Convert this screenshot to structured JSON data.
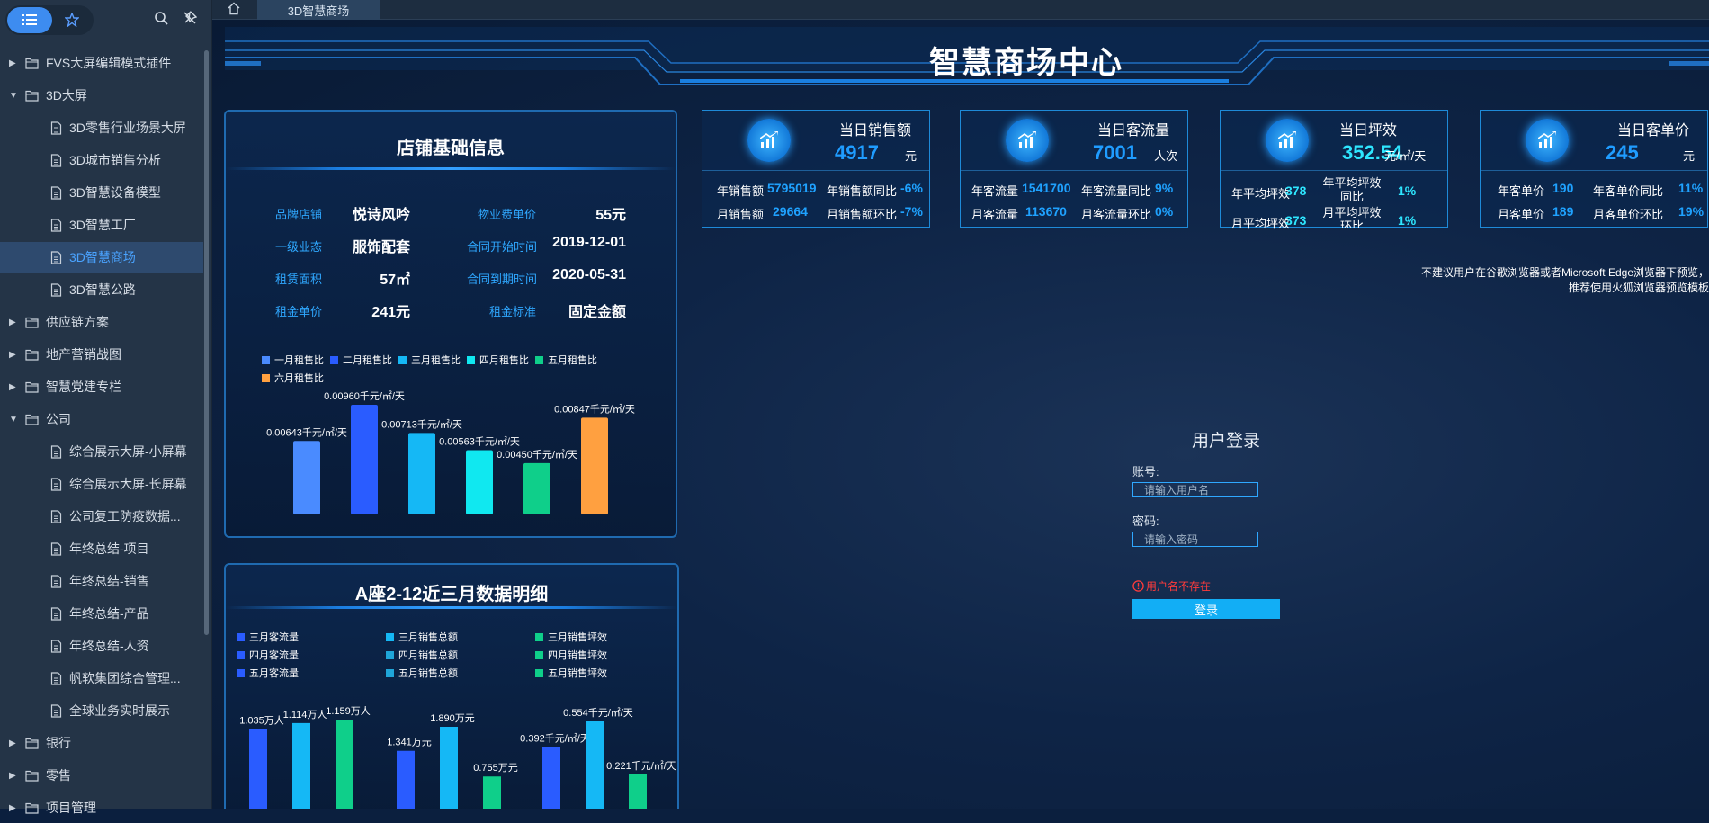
{
  "tree": [
    {
      "label": "FVS大屏编辑模式插件",
      "type": "folder",
      "expanded": false
    },
    {
      "label": "3D大屏",
      "type": "folder",
      "expanded": true
    },
    {
      "label": "3D零售行业场景大屏",
      "type": "file"
    },
    {
      "label": "3D城市销售分析",
      "type": "file"
    },
    {
      "label": "3D智慧设备模型",
      "type": "file"
    },
    {
      "label": "3D智慧工厂",
      "type": "file"
    },
    {
      "label": "3D智慧商场",
      "type": "file",
      "active": true
    },
    {
      "label": "3D智慧公路",
      "type": "file"
    },
    {
      "label": "供应链方案",
      "type": "folder",
      "expanded": false
    },
    {
      "label": "地产营销战图",
      "type": "folder",
      "expanded": false
    },
    {
      "label": "智慧党建专栏",
      "type": "folder",
      "expanded": false
    },
    {
      "label": "公司",
      "type": "folder",
      "expanded": true
    },
    {
      "label": "综合展示大屏-小屏幕",
      "type": "file"
    },
    {
      "label": "综合展示大屏-长屏幕",
      "type": "file"
    },
    {
      "label": "公司复工防疫数据...",
      "type": "file"
    },
    {
      "label": "年终总结-项目",
      "type": "file"
    },
    {
      "label": "年终总结-销售",
      "type": "file"
    },
    {
      "label": "年终总结-产品",
      "type": "file"
    },
    {
      "label": "年终总结-人资",
      "type": "file"
    },
    {
      "label": "帆软集团综合管理...",
      "type": "file"
    },
    {
      "label": "全球业务实时展示",
      "type": "file"
    },
    {
      "label": "银行",
      "type": "folder",
      "expanded": false
    },
    {
      "label": "零售",
      "type": "folder",
      "expanded": false
    },
    {
      "label": "项目管理",
      "type": "folder",
      "expanded": false
    }
  ],
  "tabs": {
    "active": "3D智慧商场"
  },
  "dashboard": {
    "title": "智慧商场中心",
    "store_panel": {
      "title": "店铺基础信息",
      "fields": [
        {
          "label": "品牌店铺",
          "value": "悦诗风吟"
        },
        {
          "label": "物业费单价",
          "value": "55元"
        },
        {
          "label": "一级业态",
          "value": "服饰配套"
        },
        {
          "label": "合同开始时间",
          "value": "2019-12-01"
        },
        {
          "label": "租赁面积",
          "value": "57㎡"
        },
        {
          "label": "合同到期时间",
          "value": "2020-05-31"
        },
        {
          "label": "租金单价",
          "value": "241元"
        },
        {
          "label": "租金标准",
          "value": "固定金额"
        }
      ]
    },
    "detail_panel": {
      "title": "A座2-12近三月数据明细"
    },
    "kpis": [
      {
        "title": "当日销售额",
        "value": "4917",
        "unit": "元",
        "stats": [
          {
            "label": "年销售额",
            "value": "5795019"
          },
          {
            "label": "年销售额同比",
            "value": "-6%"
          },
          {
            "label": "月销售额",
            "value": "29664"
          },
          {
            "label": "月销售额环比",
            "value": "-7%"
          }
        ]
      },
      {
        "title": "当日客流量",
        "value": "7001",
        "unit": "人次",
        "stats": [
          {
            "label": "年客流量",
            "value": "1541700"
          },
          {
            "label": "年客流量同比",
            "value": "9%"
          },
          {
            "label": "月客流量",
            "value": "113670"
          },
          {
            "label": "月客流量环比",
            "value": "0%"
          }
        ]
      },
      {
        "title": "当日坪效",
        "value": "352.54",
        "unit": "元/㎡/天",
        "stats": [
          {
            "label": "年平均坪效",
            "value": "378"
          },
          {
            "label": "年平均坪效同比",
            "value": "1%"
          },
          {
            "label": "月平均坪效",
            "value": "373"
          },
          {
            "label": "月平均坪效环比",
            "value": "1%"
          }
        ]
      },
      {
        "title": "当日客单价",
        "value": "245",
        "unit": "元",
        "stats": [
          {
            "label": "年客单价",
            "value": "190"
          },
          {
            "label": "年客单价同比",
            "value": "11%"
          },
          {
            "label": "月客单价",
            "value": "189"
          },
          {
            "label": "月客单价环比",
            "value": "19%"
          }
        ]
      }
    ],
    "notice_line1": "不建议用户在谷歌浏览器或者Microsoft Edge浏览器下预览，",
    "notice_line2": "推荐使用火狐浏览器预览模板"
  },
  "login": {
    "title": "用户登录",
    "account_label": "账号:",
    "account_placeholder": "请输入用户名",
    "password_label": "密码:",
    "password_placeholder": "请输入密码",
    "error": "用户名不存在",
    "button": "登录"
  },
  "chart_data": [
    {
      "type": "bar",
      "categories": [
        "一月租售比",
        "二月租售比",
        "三月租售比",
        "四月租售比",
        "五月租售比",
        "六月租售比"
      ],
      "values": [
        0.00643,
        0.0096,
        0.00713,
        0.00563,
        0.0045,
        0.00847
      ],
      "labels": [
        "0.00643千元/㎡/天",
        "0.00960千元/㎡/天",
        "0.00713千元/㎡/天",
        "0.00563千元/㎡/天",
        "0.00450千元/㎡/天",
        "0.00847千元/㎡/天"
      ],
      "colors": [
        "#4a8bff",
        "#2a5cff",
        "#15b8f5",
        "#10e8f0",
        "#0fcf8a",
        "#ffa040"
      ]
    },
    {
      "type": "bar",
      "categories": [
        "三月客流量",
        "四月客流量",
        "五月客流量",
        "三月销售总额",
        "四月销售总额",
        "五月销售总额",
        "三月销售坪效",
        "四月销售坪效",
        "五月销售坪效"
      ],
      "groups": [
        {
          "values": [
            1.035,
            1.114,
            1.159
          ],
          "labels": [
            "1.035万人",
            "1.114万人",
            "1.159万人"
          ]
        },
        {
          "values": [
            1.341,
            1.89,
            0.755
          ],
          "labels": [
            "1.341万元",
            "1.890万元",
            "0.755万元"
          ]
        },
        {
          "values": [
            0.392,
            0.554,
            0.221
          ],
          "labels": [
            "0.392千元/㎡/天",
            "0.554千元/㎡/天",
            "0.221千元/㎡/天"
          ]
        }
      ],
      "colors": [
        "#2a5cff",
        "#15b8f5",
        "#0fcf8a"
      ],
      "legend_colors": [
        "#2a5cff",
        "#2a5cff",
        "#2a5cff",
        "#15b8f5",
        "#1fa6d9",
        "#1fa6d9",
        "#0fcf8a",
        "#0fcf8a",
        "#0fcf8a"
      ]
    }
  ]
}
